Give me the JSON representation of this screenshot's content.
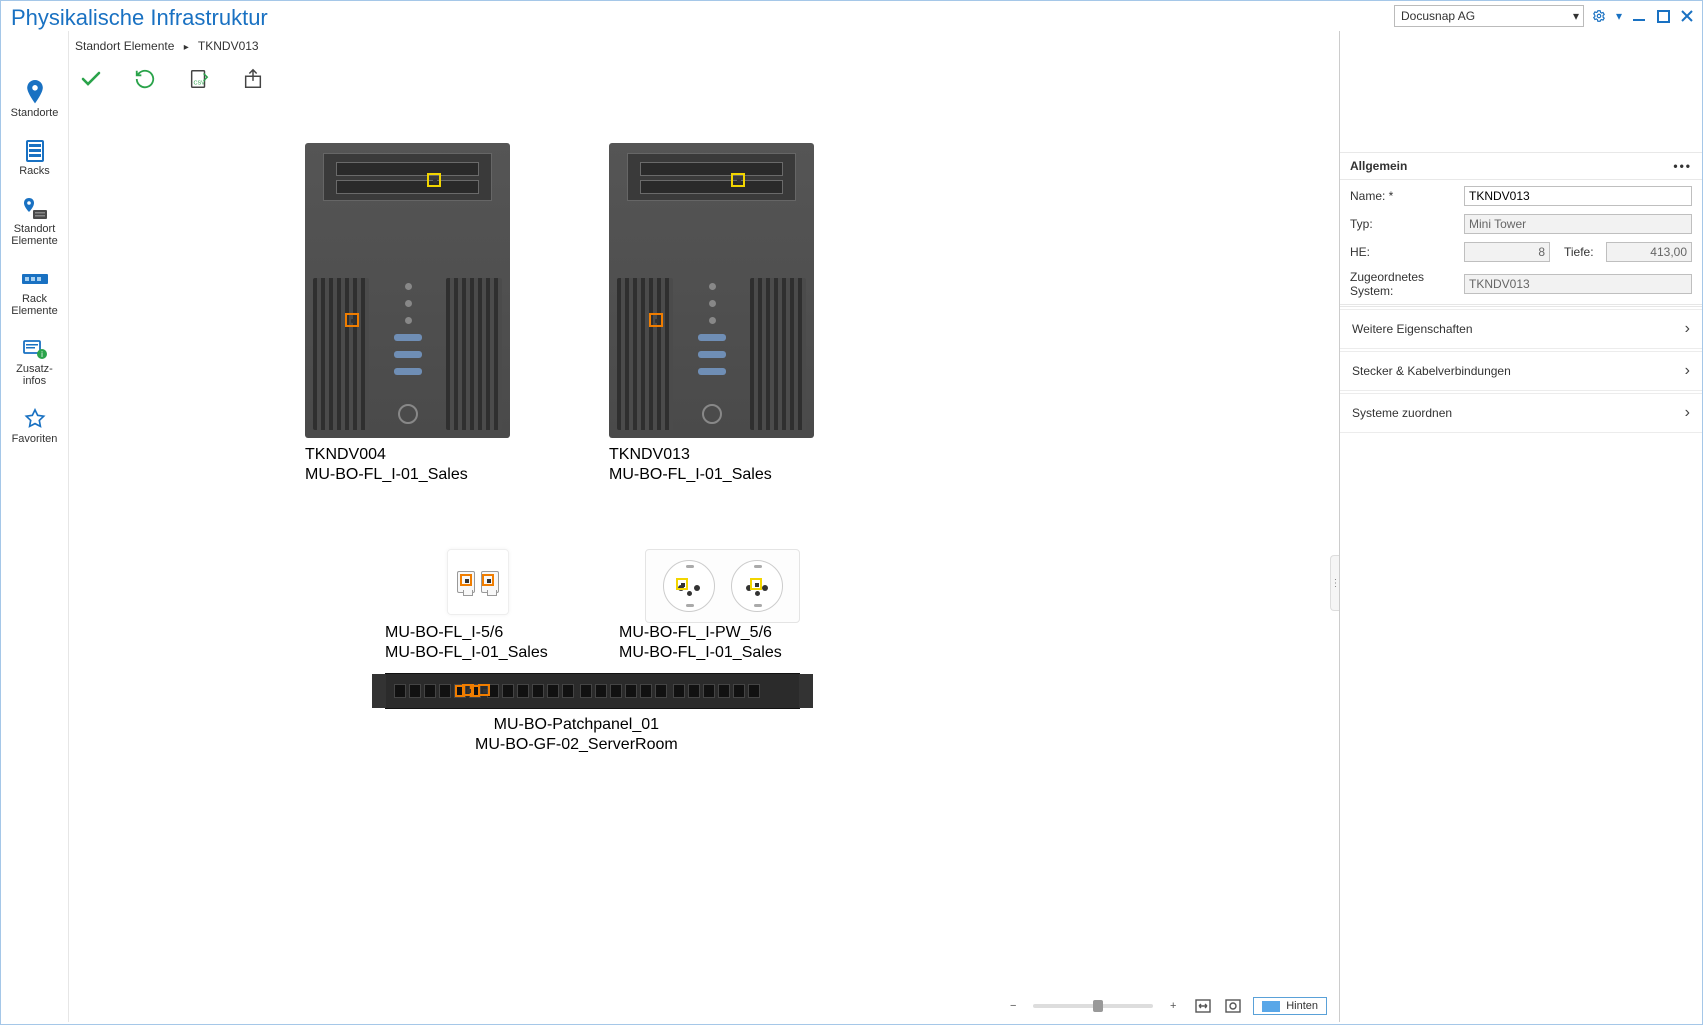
{
  "header": {
    "title": "Physikalische Infrastruktur",
    "org": "Docusnap AG"
  },
  "breadcrumb": {
    "a": "Standort Elemente",
    "b": "TKNDV013"
  },
  "leftnav": {
    "standorte": "Standorte",
    "racks": "Racks",
    "standort_elemente_l1": "Standort",
    "standort_elemente_l2": "Elemente",
    "rack_elemente_l1": "Rack",
    "rack_elemente_l2": "Elemente",
    "zusatz_l1": "Zusatz-",
    "zusatz_l2": "infos",
    "favoriten": "Favoriten"
  },
  "diagram": {
    "tower1": {
      "name": "TKNDV004",
      "loc": "MU-BO-FL_I-01_Sales"
    },
    "tower2": {
      "name": "TKNDV013",
      "loc": "MU-BO-FL_I-01_Sales"
    },
    "panel": {
      "name": "MU-BO-FL_I-5/6",
      "loc": "MU-BO-FL_I-01_Sales"
    },
    "power": {
      "name": "MU-BO-FL_I-PW_5/6",
      "loc": "MU-BO-FL_I-01_Sales"
    },
    "patch": {
      "name": "MU-BO-Patchpanel_01",
      "loc": "MU-BO-GF-02_ServerRoom"
    }
  },
  "panel": {
    "head": "Allgemein",
    "name_label": "Name: *",
    "name_value": "TKNDV013",
    "type_label": "Typ:",
    "type_value": "Mini Tower",
    "he_label": "HE:",
    "he_value": "8",
    "depth_label": "Tiefe:",
    "depth_value": "413,00",
    "assigned_label": "Zugeordnetes System:",
    "assigned_value": "TKNDV013",
    "sec1": "Weitere Eigenschaften",
    "sec2": "Stecker & Kabelverbindungen",
    "sec3": "Systeme zuordnen"
  },
  "bottom": {
    "hinten": "Hinten"
  }
}
